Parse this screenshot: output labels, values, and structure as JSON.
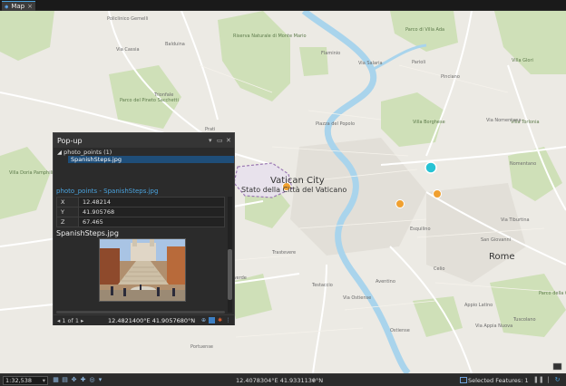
{
  "tab": {
    "label": "Map",
    "close": "×"
  },
  "popup": {
    "title": "Pop-up",
    "layer_label": "photo_points (1)",
    "selected_item": "SpanishSteps.jpg",
    "feature_title": "photo_points - SpanishSteps.jpg",
    "attributes": [
      {
        "key": "X",
        "value": "12.48214"
      },
      {
        "key": "Y",
        "value": "41.905768"
      },
      {
        "key": "Z",
        "value": "67.465"
      }
    ],
    "image_label": "SpanishSteps.jpg",
    "pager": "1 of 1",
    "coordinate": "12.4821400°E 41.9057680°N"
  },
  "status": {
    "scale": "1:32,538",
    "coordinate": "12.4078304°E 41.9331130°N",
    "selected_features": "Selected Features: 1"
  },
  "map": {
    "labels": [
      {
        "text": "Vatican City",
        "class": "big"
      },
      {
        "text": "Rome",
        "class": "big"
      },
      {
        "text": "Stato della Città del Vaticano",
        "class": "area"
      },
      {
        "text": "Villa Borghese",
        "class": "park"
      },
      {
        "text": "Parco di Villa Ada",
        "class": "park"
      },
      {
        "text": "Villa Torlonia",
        "class": "park"
      },
      {
        "text": "Villa Glori",
        "class": "park"
      },
      {
        "text": "Riserva Naturale di Monte Mario",
        "class": "park"
      },
      {
        "text": "Parco del Pineto Sacchetti",
        "class": "park"
      },
      {
        "text": "Villa Doria Pamphili",
        "class": "park"
      },
      {
        "text": "Parco della Caffarella",
        "class": "park"
      },
      {
        "text": "Policlinico Gemelli",
        "class": ""
      },
      {
        "text": "Via Cassia",
        "class": ""
      },
      {
        "text": "Via Aurelia",
        "class": ""
      },
      {
        "text": "Via Salaria",
        "class": ""
      },
      {
        "text": "Via Nomentana",
        "class": ""
      },
      {
        "text": "Via Tiburtina",
        "class": ""
      },
      {
        "text": "Via Appia Nuova",
        "class": ""
      },
      {
        "text": "Via Ostiense",
        "class": ""
      },
      {
        "text": "Prati",
        "class": ""
      },
      {
        "text": "Flaminio",
        "class": ""
      },
      {
        "text": "Trastevere",
        "class": ""
      },
      {
        "text": "Testaccio",
        "class": ""
      },
      {
        "text": "Monteverde",
        "class": ""
      },
      {
        "text": "Nomentano",
        "class": ""
      },
      {
        "text": "Pinciano",
        "class": ""
      },
      {
        "text": "San Giovanni",
        "class": ""
      },
      {
        "text": "Piazza del Popolo",
        "class": ""
      },
      {
        "text": "Esquilino",
        "class": ""
      },
      {
        "text": "Celio",
        "class": ""
      },
      {
        "text": "Aventino",
        "class": ""
      },
      {
        "text": "Ostiense",
        "class": ""
      },
      {
        "text": "Appio Latino",
        "class": ""
      },
      {
        "text": "Tuscolano",
        "class": ""
      },
      {
        "text": "Parioli",
        "class": ""
      },
      {
        "text": "Trionfale",
        "class": ""
      },
      {
        "text": "Balduina",
        "class": ""
      },
      {
        "text": "Aurelio",
        "class": ""
      },
      {
        "text": "Gianicolense",
        "class": ""
      },
      {
        "text": "Portuense",
        "class": ""
      }
    ]
  },
  "colors": {
    "accent": "#4aa3df",
    "selection": "#1f4e79",
    "park": "#cfe0b8",
    "river": "#a9d4ec",
    "marker": "#f0a030",
    "highlight": "#27c3d4"
  }
}
